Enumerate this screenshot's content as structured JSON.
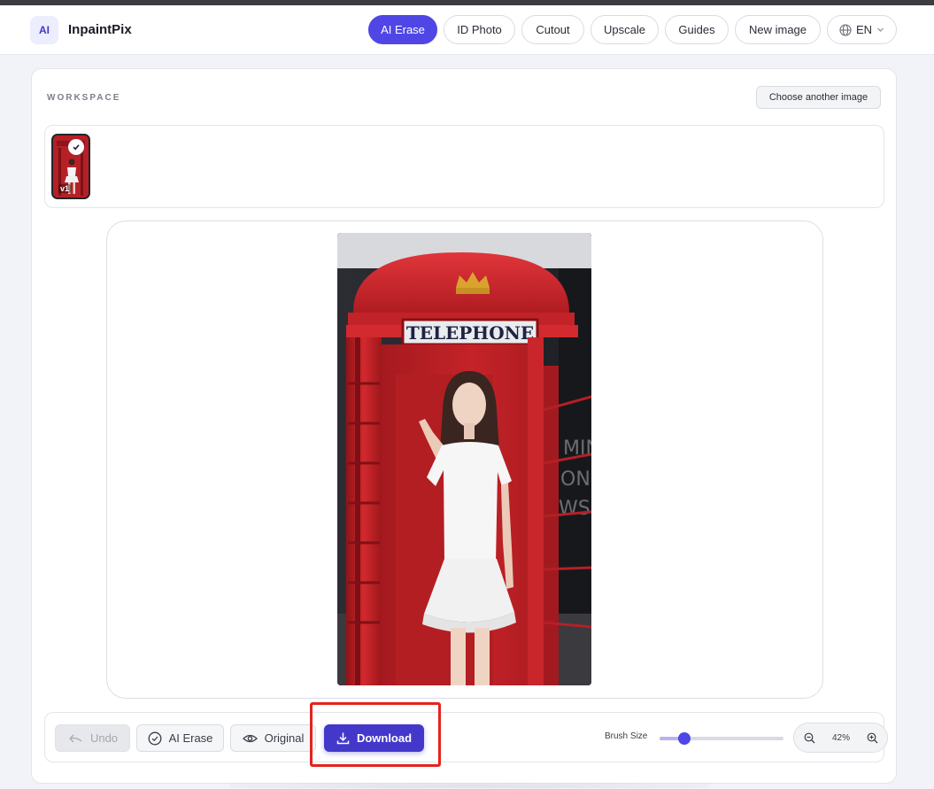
{
  "app": {
    "logo_badge": "AI",
    "name": "InpaintPix"
  },
  "nav": {
    "items": [
      {
        "label": "AI Erase",
        "active": true
      },
      {
        "label": "ID Photo",
        "active": false
      },
      {
        "label": "Cutout",
        "active": false
      },
      {
        "label": "Upscale",
        "active": false
      },
      {
        "label": "Guides",
        "active": false
      },
      {
        "label": "New image",
        "active": false
      }
    ],
    "language": "EN"
  },
  "workspace": {
    "label": "WORKSPACE",
    "choose_button": "Choose another image",
    "versions": [
      {
        "label": "v1",
        "selected": true
      }
    ]
  },
  "photo": {
    "sign_text": "TELEPHONE"
  },
  "toolbar": {
    "undo": "Undo",
    "ai_erase": "AI Erase",
    "original": "Original",
    "download": "Download",
    "brush_label": "Brush Size",
    "brush_level": 0.2,
    "zoom": "42%"
  },
  "colors": {
    "accent": "#4f46e5",
    "download_bg": "#4338ca",
    "highlight": "#e4231d"
  },
  "icons": [
    "globe-icon",
    "chevron-down-icon",
    "check-icon",
    "undo-icon",
    "check-circle-icon",
    "eye-icon",
    "download-icon",
    "zoom-out-icon",
    "zoom-in-icon",
    "crown-icon"
  ]
}
